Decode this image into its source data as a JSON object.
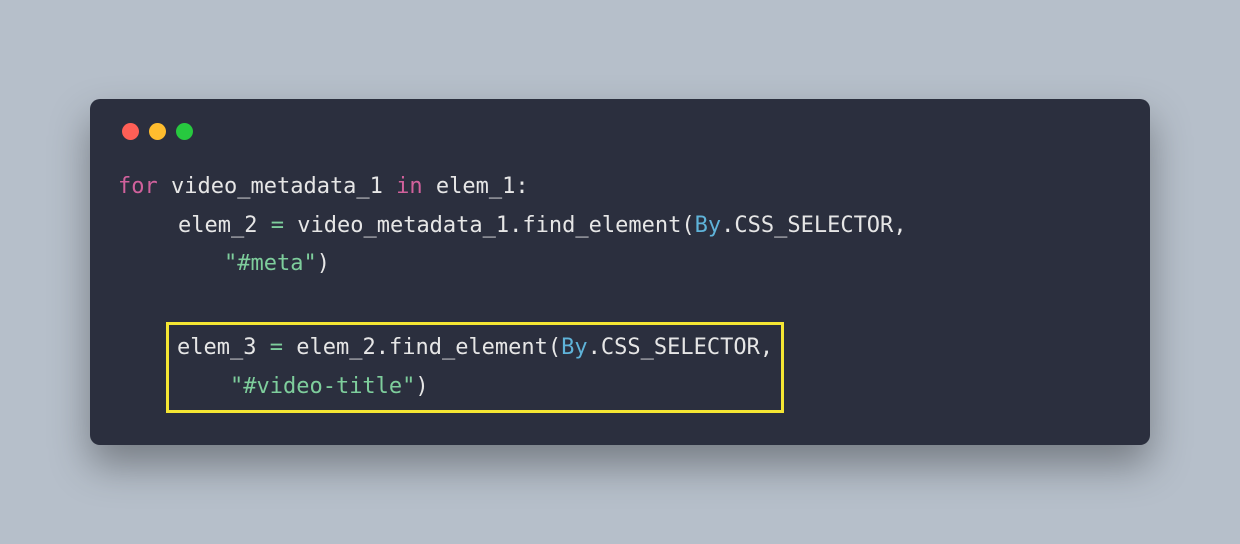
{
  "code": {
    "line1": {
      "for": "for",
      "var1": "video_metadata_1",
      "in": "in",
      "var2": "elem_1",
      "colon": ":"
    },
    "line2": {
      "var": "elem_2",
      "eq": "=",
      "obj": "video_metadata_1",
      "dot": ".",
      "method": "find_element",
      "lparen": "(",
      "cls": "By",
      "dot2": ".",
      "attr": "CSS_SELECTOR",
      "comma": ","
    },
    "line3": {
      "str": "\"#meta\"",
      "rparen": ")"
    },
    "line4": {
      "var": "elem_3",
      "eq": "=",
      "obj": "elem_2",
      "dot": ".",
      "method": "find_element",
      "lparen": "(",
      "cls": "By",
      "dot2": ".",
      "attr": "CSS_SELECTOR",
      "comma": ","
    },
    "line5": {
      "str": "\"#video-title\"",
      "rparen": ")"
    }
  },
  "colors": {
    "red": "#ff5f56",
    "yellow": "#ffbd2e",
    "green": "#27c93f",
    "highlight_border": "#f5e633"
  }
}
